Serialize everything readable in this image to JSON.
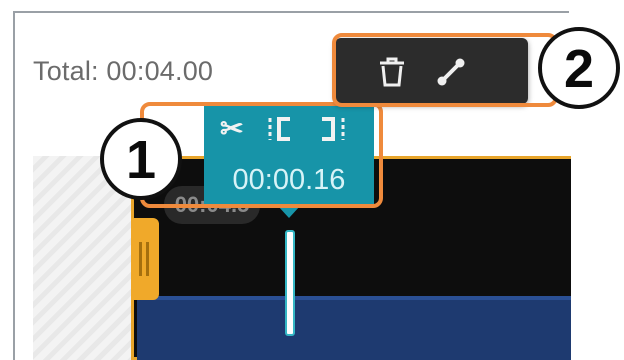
{
  "timeline": {
    "total_label": "Total: 00:04.00",
    "clip_duration_tag": "00:04.5"
  },
  "split_tooltip": {
    "time": "00:00.16",
    "tools": [
      {
        "icon": "scissors-icon",
        "action": "split"
      },
      {
        "icon": "trim-start-icon",
        "action": "trim-start"
      },
      {
        "icon": "trim-end-icon",
        "action": "trim-end"
      }
    ]
  },
  "clip_toolbar": {
    "tools": [
      {
        "icon": "trash-icon",
        "action": "delete"
      },
      {
        "icon": "link-icon",
        "action": "link"
      }
    ]
  },
  "callouts": {
    "one": "1",
    "two": "2"
  },
  "colors": {
    "accent_teal": "#1794a8",
    "clip_border": "#e8a52b",
    "highlight_box": "#ef8a3c",
    "audio_track": "#1e3a70"
  }
}
